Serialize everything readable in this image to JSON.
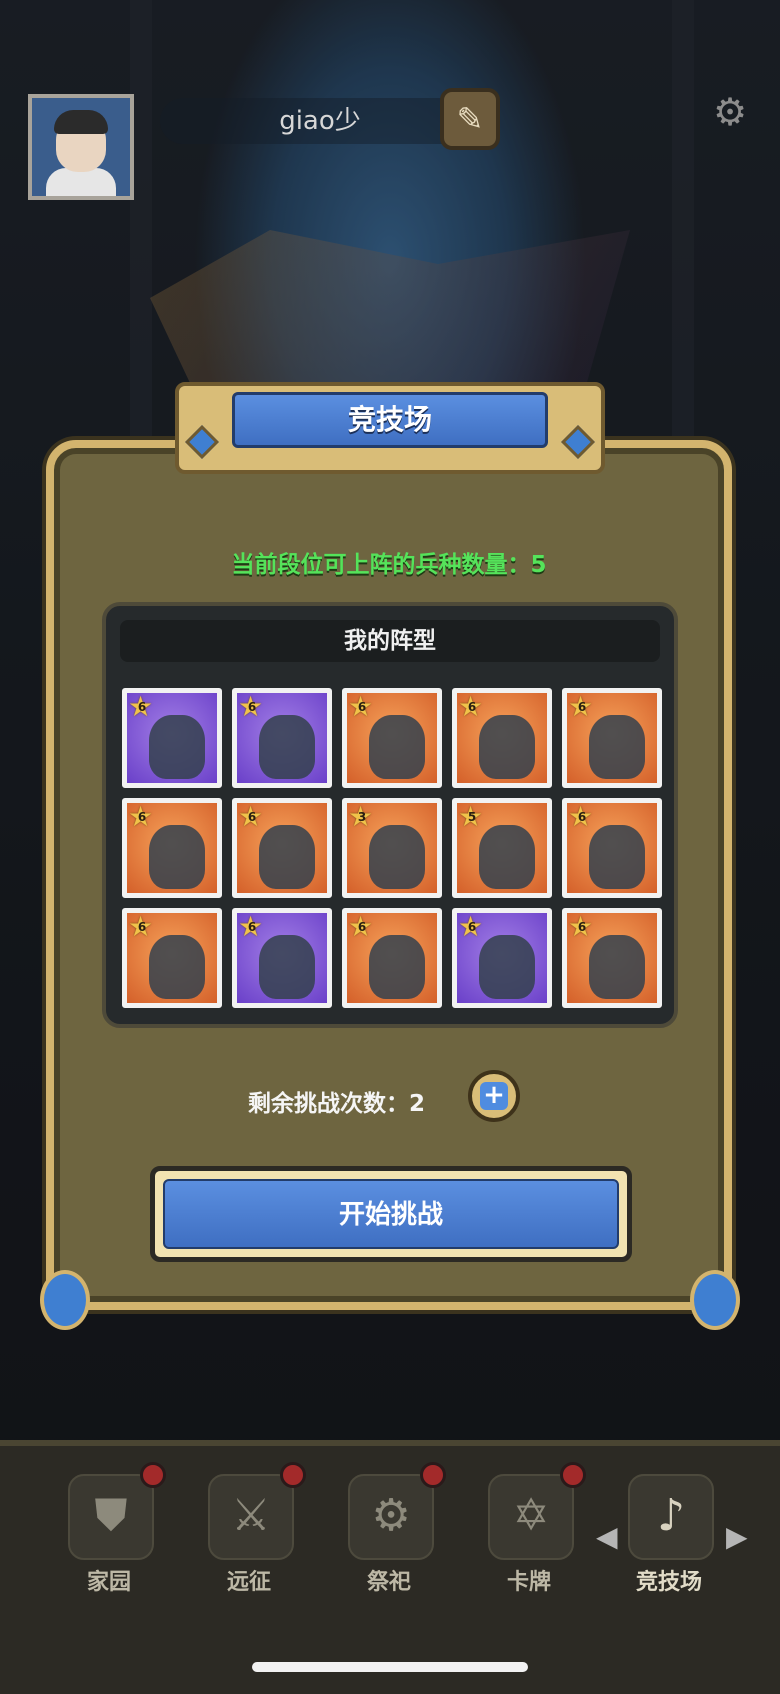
{
  "header": {
    "player_name": "giao少"
  },
  "panel": {
    "title": "竞技场",
    "slots_info": "当前段位可上阵的兵种数量：5",
    "formation_title": "我的阵型",
    "units": [
      {
        "level": "6",
        "bg": "purple"
      },
      {
        "level": "6",
        "bg": "purple"
      },
      {
        "level": "6",
        "bg": "orange"
      },
      {
        "level": "6",
        "bg": "orange"
      },
      {
        "level": "6",
        "bg": "orange"
      },
      {
        "level": "6",
        "bg": "orange"
      },
      {
        "level": "6",
        "bg": "orange"
      },
      {
        "level": "3",
        "bg": "orange"
      },
      {
        "level": "5",
        "bg": "orange"
      },
      {
        "level": "6",
        "bg": "orange"
      },
      {
        "level": "6",
        "bg": "orange"
      },
      {
        "level": "6",
        "bg": "purple"
      },
      {
        "level": "6",
        "bg": "orange"
      },
      {
        "level": "6",
        "bg": "purple"
      },
      {
        "level": "6",
        "bg": "orange"
      }
    ],
    "remaining_label": "剩余挑战次数：2",
    "start_button": "开始挑战"
  },
  "nav": {
    "items": [
      {
        "label": "家园",
        "icon": "shield-icon"
      },
      {
        "label": "远征",
        "icon": "crossed-swords-icon"
      },
      {
        "label": "祭祀",
        "icon": "altar-icon"
      },
      {
        "label": "卡牌",
        "icon": "card-icon"
      },
      {
        "label": "竞技场",
        "icon": "horn-icon"
      }
    ]
  }
}
